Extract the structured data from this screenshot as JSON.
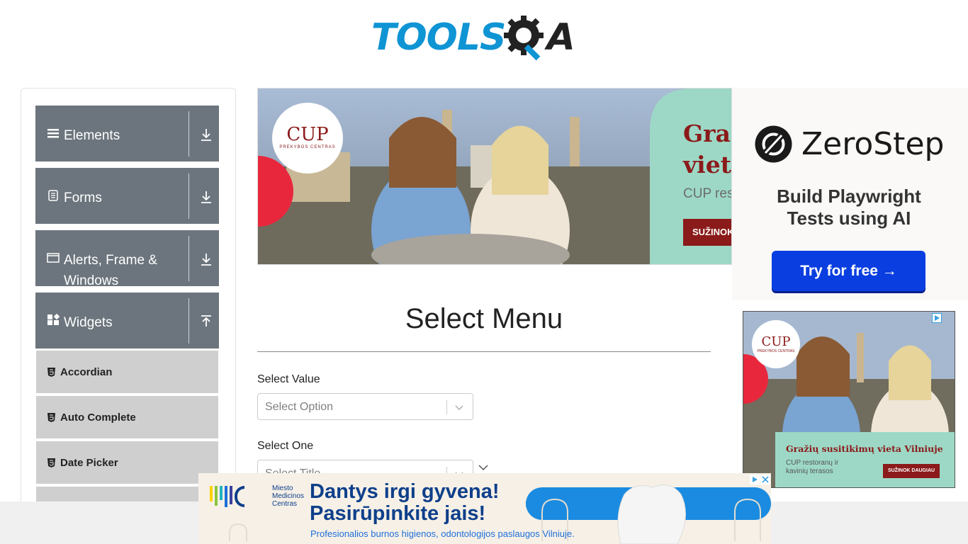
{
  "logo": {
    "part1": "TOOLS",
    "part2": "A"
  },
  "sidebar": {
    "groups": [
      {
        "label": "Elements",
        "icon": "hamburger-icon",
        "arrow": "download-icon"
      },
      {
        "label": "Forms",
        "icon": "document-icon",
        "arrow": "download-icon"
      },
      {
        "label": "Alerts, Frame & Windows",
        "icon": "window-icon",
        "arrow": "download-icon"
      },
      {
        "label": "Widgets",
        "icon": "widgets-icon",
        "arrow": "upload-icon"
      }
    ],
    "items": [
      {
        "label": "Accordian",
        "icon": "html5-icon"
      },
      {
        "label": "Auto Complete",
        "icon": "html5-icon"
      },
      {
        "label": "Date Picker",
        "icon": "html5-icon"
      }
    ]
  },
  "ad_top": {
    "brand": "CUP",
    "brand_sub": "PREKYBOS CENTRAS",
    "headline_line1": "Graž",
    "headline_line2": "vieta",
    "sub": "CUP res",
    "cta": "SUŽINOK"
  },
  "main": {
    "title": "Select Menu",
    "fields": [
      {
        "label": "Select Value",
        "placeholder": "Select Option"
      },
      {
        "label": "Select One",
        "placeholder": "Select Title"
      }
    ]
  },
  "ad_right": {
    "brand": "ZeroStep",
    "tagline_line1": "Build Playwright",
    "tagline_line2": "Tests using AI",
    "cta": "Try for free →"
  },
  "ad_right2": {
    "brand": "CUP",
    "brand_sub": "PREKYBOS CENTRAS",
    "headline": "Gražių susitikimų vieta Vilniuje",
    "sub_line1": "CUP restoranų ir",
    "sub_line2": "kavinių terasos",
    "cta": "SUŽINOK DAUGIAU"
  },
  "ad_bottom": {
    "brand_line1": "Miesto",
    "brand_line2": "Medicinos",
    "brand_line3": "Centras",
    "headline_line1": "Dantys irgi gyvena!",
    "headline_line2": "Pasirūpinkite jais!",
    "sub": "Profesionalios burnos higienos, odontologijos paslaugos Vilniuje."
  },
  "colors": {
    "accent": "#0f94d4",
    "group_bg": "#6c757d",
    "item_bg": "#cfcfcf",
    "cta_blue": "#0a3ee0",
    "cup_red": "#8b1a1a"
  }
}
